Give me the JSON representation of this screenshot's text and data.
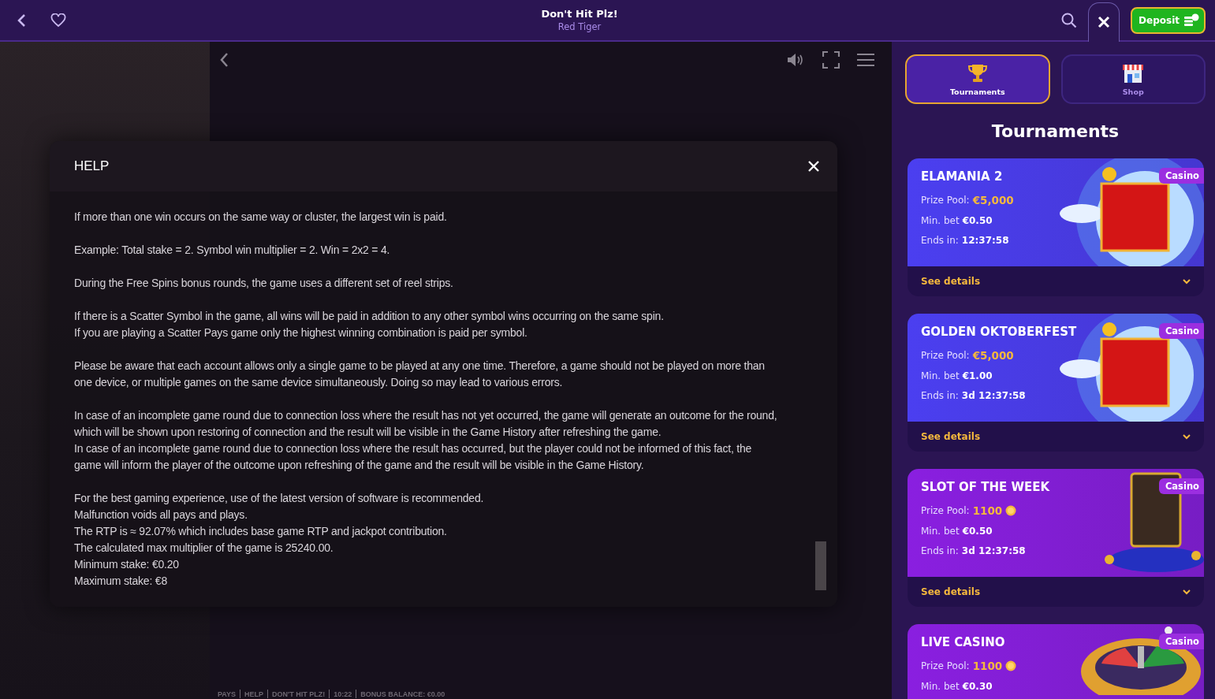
{
  "header": {
    "title": "Don't Hit Plz!",
    "provider": "Red Tiger",
    "deposit": "Deposit"
  },
  "help": {
    "title": "HELP",
    "paragraphs": [
      [
        "If more than one win occurs on the same way or cluster, the largest win is paid."
      ],
      [
        "Example: Total stake = 2. Symbol win multiplier = 2. Win = 2x2 = 4."
      ],
      [
        "During the Free Spins bonus rounds, the game uses a different set of reel strips."
      ],
      [
        "If there is a Scatter Symbol in the game, all wins will be paid in addition to any other symbol wins occurring on the same spin.",
        "If you are playing a Scatter Pays game only the highest winning combination is paid per symbol."
      ],
      [
        "Please be aware that each account allows only a single game to be played at any one time. Therefore, a game should not be played on more than",
        "one device, or multiple games on the same device simultaneously. Doing so may lead to various errors."
      ],
      [
        "In case of an incomplete game round due to connection loss where the result has not yet occurred, the game will generate an outcome for the round,",
        "which will be shown upon restoring of connection and the result will be visible in the Game History after refreshing the game.",
        "In case of an incomplete game round due to connection loss where the result has occurred, but the player could not be informed of this fact, the",
        "game will inform the player of the outcome upon refreshing of the game and the result will be visible in the Game History."
      ],
      [
        "For the best gaming experience, use of the latest version of software is recommended.",
        "Malfunction voids all pays and plays.",
        "The RTP is ≈ 92.07% which includes base game RTP and jackpot contribution.",
        "The calculated max multiplier of the game is 25240.00.",
        "Minimum stake: €0.20",
        "Maximum stake: €8"
      ]
    ]
  },
  "status_bar": [
    "PAYS",
    "HELP",
    "DON'T HIT PLZ!",
    "10:22",
    "BONUS BALANCE: €0.00"
  ],
  "tabs": [
    {
      "label": "Tournaments",
      "selected": true
    },
    {
      "label": "Shop",
      "selected": false
    }
  ],
  "panel_title": "Tournaments",
  "tournaments": [
    {
      "title": "ELAMANIA 2",
      "tag": "Casino",
      "color": "#4b3ff0",
      "kind": "carpet",
      "prize_label": "Prize Pool:",
      "prize": "€5,000",
      "coin": false,
      "bet_label": "Min. bet",
      "bet": "€0.50",
      "ends_label": "Ends in:",
      "ends": "12:37:58",
      "details": "See details"
    },
    {
      "title": "GOLDEN OKTOBERFEST",
      "tag": "Casino",
      "color": "#4b3ff0",
      "kind": "carpet",
      "prize_label": "Prize Pool:",
      "prize": "€5,000",
      "coin": false,
      "bet_label": "Min. bet",
      "bet": "€1.00",
      "ends_label": "Ends in:",
      "ends": "3d 12:37:58",
      "details": "See details"
    },
    {
      "title": "SLOT OF THE WEEK",
      "tag": "Casino",
      "color": "#8a1fe0",
      "kind": "slot",
      "prize_label": "Prize Pool:",
      "prize": "1100",
      "coin": true,
      "bet_label": "Min. bet",
      "bet": "€0.50",
      "ends_label": "Ends in:",
      "ends": "3d 12:37:58",
      "details": "See details"
    },
    {
      "title": "LIVE CASINO",
      "tag": "Casino",
      "color": "#8a1fe0",
      "kind": "roulette",
      "prize_label": "Prize Pool:",
      "prize": "1100",
      "coin": true,
      "bet_label": "Min. bet",
      "bet": "€0.30"
    }
  ]
}
